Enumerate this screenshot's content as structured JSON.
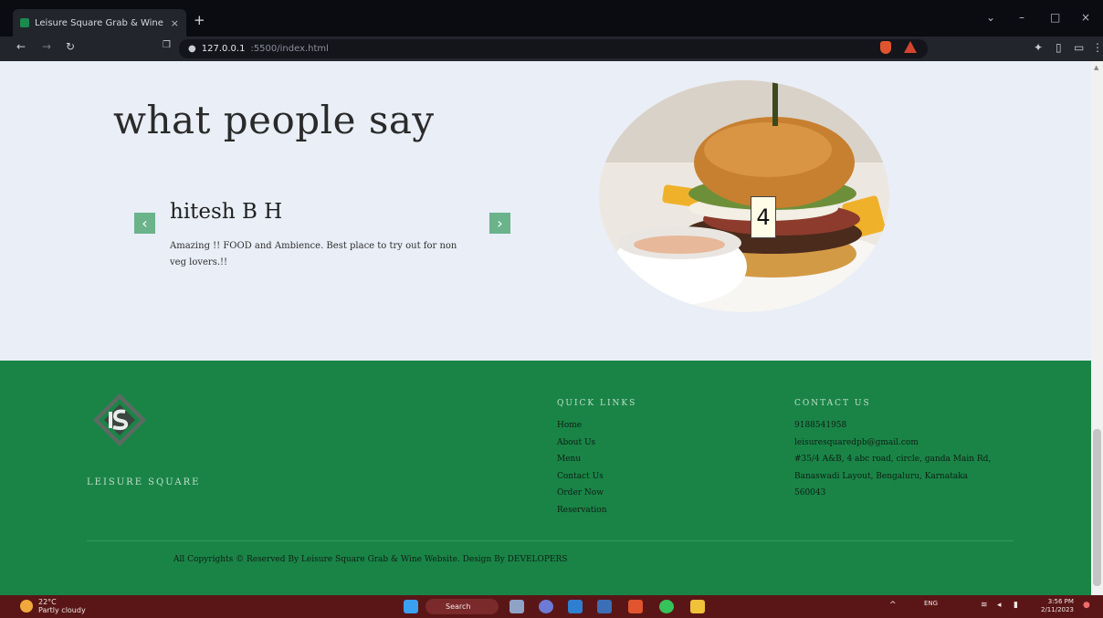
{
  "browser": {
    "tab_title": "Leisure Square Grab & Wine",
    "tab_close": "×",
    "new_tab": "+",
    "url_host": "127.0.0.1",
    "url_path": ":5500/index.html",
    "window_controls": [
      "⌄",
      "–",
      "□",
      "×"
    ]
  },
  "testimonials": {
    "heading": "what people say",
    "prev_arrow": "‹",
    "next_arrow": "›",
    "reviewer": "hitesh B H",
    "review": "Amazing !! FOOD and Ambience. Best place to try out for non veg lovers.!!",
    "slide_number": "4"
  },
  "footer": {
    "brand": "LEISURE SQUARE",
    "quick_links_title": "QUICK LINKS",
    "quick_links": [
      "Home",
      "About Us",
      "Menu",
      "Contact Us",
      "Order Now",
      "Reservation"
    ],
    "contact_title": "CONTACT US",
    "contact_lines": [
      "9188541958",
      "leisuresquaredpb@gmail.com",
      "#35/4 A&B, 4 abc road, circle, ganda Main Rd,",
      "Banaswadi Layout, Bengaluru, Karnataka",
      "560043"
    ],
    "copyright": "All Copyrights © Reserved By Leisure Square Grab & Wine Website. Design By DEVELOPERS"
  },
  "taskbar": {
    "temperature": "22°C",
    "weather_text": "Partly cloudy",
    "search_label": "Search",
    "language": "ENG",
    "time": "3:56 PM",
    "date": "2/11/2023"
  },
  "colors": {
    "footer_green": "#1a8447",
    "arrow_green": "#6ab38b",
    "page_bg": "#e9eef7",
    "taskbar": "#5a1616"
  }
}
